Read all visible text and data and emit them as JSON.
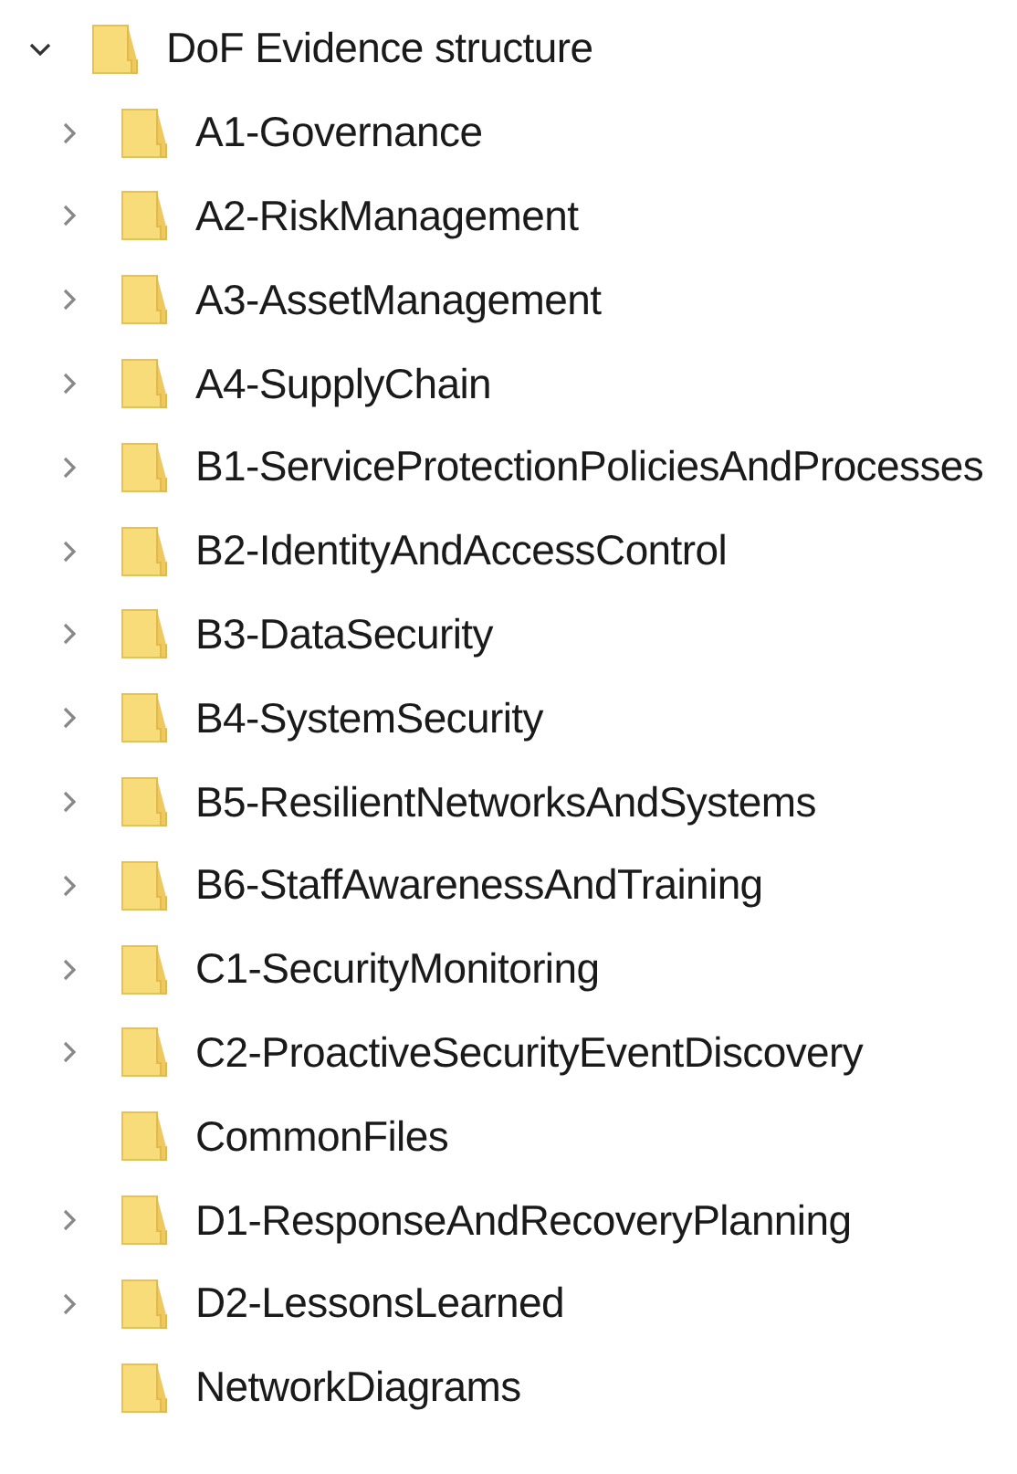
{
  "tree": [
    {
      "label": "DoF Evidence structure",
      "expandable": true,
      "expanded": true,
      "children": [
        {
          "label": "A1-Governance",
          "expandable": true,
          "expanded": false
        },
        {
          "label": "A2-RiskManagement",
          "expandable": true,
          "expanded": false
        },
        {
          "label": "A3-AssetManagement",
          "expandable": true,
          "expanded": false
        },
        {
          "label": "A4-SupplyChain",
          "expandable": true,
          "expanded": false
        },
        {
          "label": "B1-ServiceProtectionPoliciesAndProcesses",
          "expandable": true,
          "expanded": false
        },
        {
          "label": "B2-IdentityAndAccessControl",
          "expandable": true,
          "expanded": false
        },
        {
          "label": "B3-DataSecurity",
          "expandable": true,
          "expanded": false
        },
        {
          "label": "B4-SystemSecurity",
          "expandable": true,
          "expanded": false
        },
        {
          "label": "B5-ResilientNetworksAndSystems",
          "expandable": true,
          "expanded": false
        },
        {
          "label": "B6-StaffAwarenessAndTraining",
          "expandable": true,
          "expanded": false
        },
        {
          "label": "C1-SecurityMonitoring",
          "expandable": true,
          "expanded": false
        },
        {
          "label": "C2-ProactiveSecurityEventDiscovery",
          "expandable": true,
          "expanded": false
        },
        {
          "label": "CommonFiles",
          "expandable": false
        },
        {
          "label": "D1-ResponseAndRecoveryPlanning",
          "expandable": true,
          "expanded": false
        },
        {
          "label": "D2-LessonsLearned",
          "expandable": true,
          "expanded": false
        },
        {
          "label": "NetworkDiagrams",
          "expandable": false
        }
      ]
    }
  ]
}
